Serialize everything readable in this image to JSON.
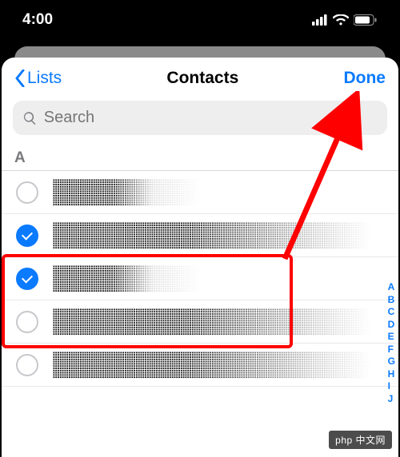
{
  "status": {
    "time": "4:00"
  },
  "nav": {
    "back_label": "Lists",
    "title": "Contacts",
    "done_label": "Done"
  },
  "search": {
    "placeholder": "Search",
    "value": ""
  },
  "section": {
    "header": "A"
  },
  "rows": [
    {
      "checked": false
    },
    {
      "checked": true
    },
    {
      "checked": true
    },
    {
      "checked": false
    },
    {
      "checked": false
    }
  ],
  "index_bar": [
    "A",
    "B",
    "C",
    "D",
    "E",
    "F",
    "G",
    "H",
    "I",
    "J"
  ],
  "watermark": "php 中文网"
}
